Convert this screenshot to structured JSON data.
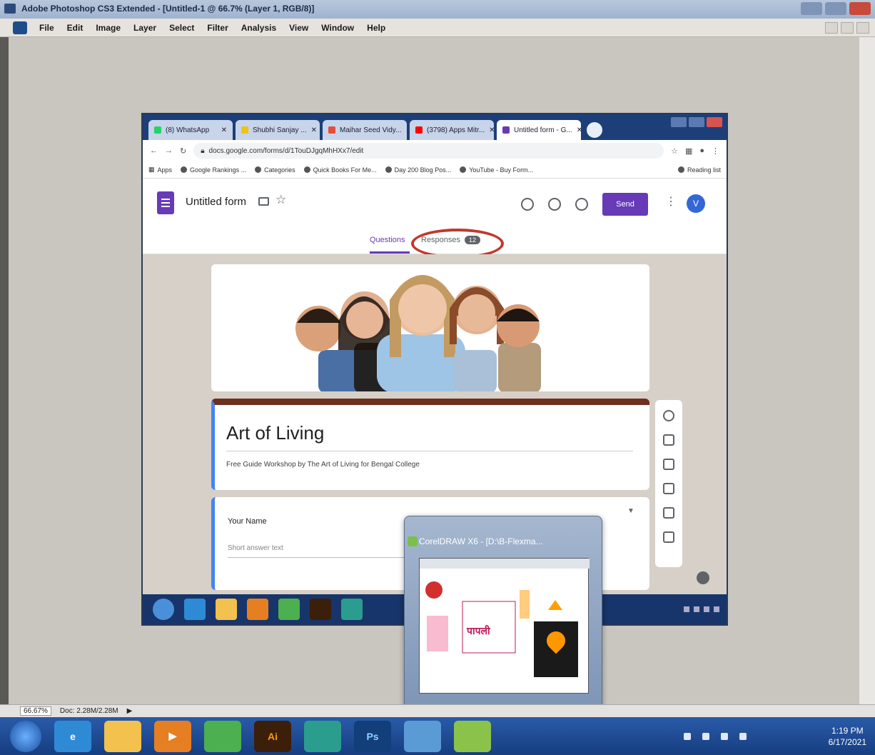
{
  "photoshop": {
    "title": "Adobe Photoshop CS3 Extended - [Untitled-1 @ 66.7% (Layer 1, RGB/8)]",
    "menu": [
      "File",
      "Edit",
      "Image",
      "Layer",
      "Select",
      "Filter",
      "Analysis",
      "View",
      "Window",
      "Help"
    ],
    "status": {
      "zoom": "66.67%",
      "doc": "Doc: 2.28M/2.28M"
    }
  },
  "browser": {
    "tabs": [
      {
        "label": "(8) WhatsApp",
        "color": "#25d366"
      },
      {
        "label": "Shubhi Sanjay ...",
        "color": "#f1c40f"
      },
      {
        "label": "Maihar Seed Vidy...",
        "color": "#e74c3c"
      },
      {
        "label": "(3798) Apps Mitr...",
        "color": "#ff0000"
      },
      {
        "label": "Untitled form - G...",
        "color": "#673ab7"
      }
    ],
    "url": "docs.google.com/forms/d/1TouDJgqMhHXx7/edit",
    "bookmarks": [
      "Apps",
      "Google Rankings ...",
      "Categories",
      "Quick Books For Me...",
      "Day 200 Blog Pos...",
      "YouTube - Buy Form..."
    ],
    "reading_list": "Reading list"
  },
  "form": {
    "title": "Untitled form",
    "send_label": "Send",
    "avatar_letter": "V",
    "tabs": {
      "questions": "Questions",
      "responses": "Responses",
      "responses_count": "12"
    },
    "heading": "Art of Living",
    "description": "Free Guide Workshop by The Art of Living for Bengal College",
    "question_label": "Your Name",
    "answer_placeholder": "Short answer text"
  },
  "corel": {
    "title": "CorelDRAW X6 - [D:\\B-Flexma...",
    "brand": "पापली"
  },
  "taskbar": {
    "apps": [
      {
        "name": "ie",
        "color": "#2f8ad6",
        "text": "e"
      },
      {
        "name": "explorer",
        "color": "#f2c14e",
        "text": ""
      },
      {
        "name": "media-player",
        "color": "#e67e22",
        "text": "▶"
      },
      {
        "name": "chrome",
        "color": "#4caf50",
        "text": ""
      },
      {
        "name": "illustrator",
        "color": "#3b1f0b",
        "text": "Ai"
      },
      {
        "name": "app-teal",
        "color": "#2a9d8f",
        "text": ""
      },
      {
        "name": "photoshop",
        "color": "#123e7a",
        "text": "Ps"
      },
      {
        "name": "app-blue",
        "color": "#5b9bd5",
        "text": ""
      },
      {
        "name": "coreldraw",
        "color": "#8bc34a",
        "text": ""
      }
    ],
    "time": "1:19 PM",
    "date": "6/17/2021"
  }
}
